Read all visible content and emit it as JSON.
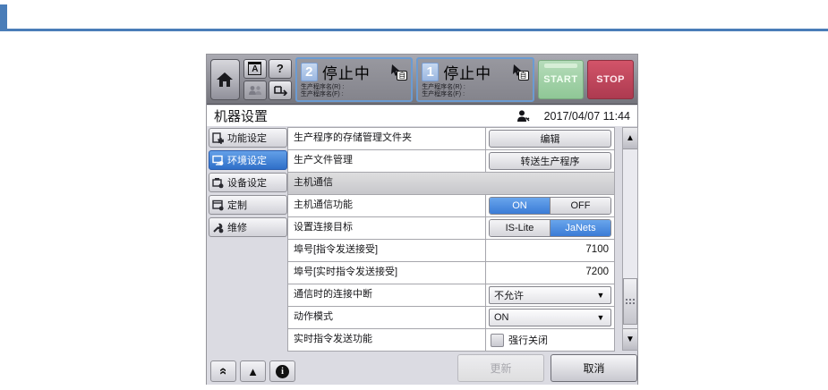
{
  "colors": {
    "accent": "#4a7db8",
    "selected_blue": "#3a7bd6",
    "start_green": "#9fcfa5",
    "stop_red": "#c44a5f"
  },
  "toolbar": {
    "char_button": "A",
    "help_button": "?",
    "stations": [
      {
        "number": "2",
        "status": "停止中",
        "program_r": "生产程序名(R) :",
        "program_f": "生产程序名(F) :",
        "mode_char": "自"
      },
      {
        "number": "1",
        "status": "停止中",
        "program_r": "生产程序名(R) :",
        "program_f": "生产程序名(F) :",
        "mode_char": "自"
      }
    ],
    "start_label": "START",
    "stop_label": "STOP"
  },
  "titlebar": {
    "title": "机器设置",
    "datetime": "2017/04/07 11:44"
  },
  "sidebar": {
    "items": [
      {
        "label": "功能设定",
        "selected": false
      },
      {
        "label": "环境设定",
        "selected": true
      },
      {
        "label": "设备设定",
        "selected": false
      },
      {
        "label": "定制",
        "selected": false
      },
      {
        "label": "维修",
        "selected": false
      }
    ]
  },
  "settings": {
    "rows": [
      {
        "type": "button",
        "label": "生产程序的存储管理文件夹",
        "button_label": "编辑"
      },
      {
        "type": "button",
        "label": "生产文件管理",
        "button_label": "转送生产程序"
      },
      {
        "type": "section",
        "label": "主机通信"
      },
      {
        "type": "segmented",
        "label": "主机通信功能",
        "options": [
          "ON",
          "OFF"
        ],
        "selected": "ON"
      },
      {
        "type": "segmented",
        "label": "设置连接目标",
        "options": [
          "IS-Lite",
          "JaNets"
        ],
        "selected": "JaNets"
      },
      {
        "type": "number",
        "label": "埠号[指令发送接受]",
        "value": "7100"
      },
      {
        "type": "number",
        "label": "埠号[实时指令发送接受]",
        "value": "7200"
      },
      {
        "type": "dropdown",
        "label": "通信时的连接中断",
        "value": "不允许"
      },
      {
        "type": "dropdown",
        "label": "动作模式",
        "value": "ON"
      },
      {
        "type": "checkbox",
        "label": "实时指令发送功能",
        "checkbox_label": "强行关闭",
        "checked": false
      }
    ]
  },
  "footer": {
    "update_label": "更新",
    "cancel_label": "取消"
  },
  "scrollbar": {
    "up": "▲",
    "down": "▼"
  },
  "bottom_tools": {
    "collapse": "»",
    "warning": "▲",
    "info": "i"
  }
}
